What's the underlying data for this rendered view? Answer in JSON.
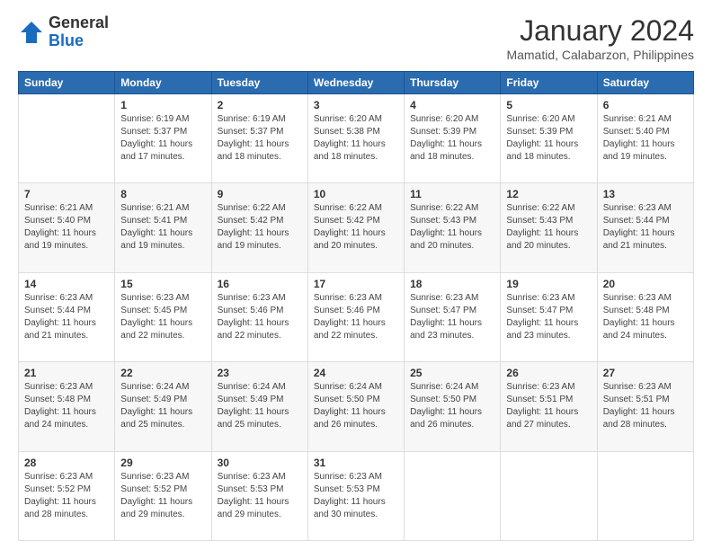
{
  "header": {
    "logo_line1": "General",
    "logo_line2": "Blue",
    "title": "January 2024",
    "subtitle": "Mamatid, Calabarzon, Philippines"
  },
  "calendar": {
    "days_of_week": [
      "Sunday",
      "Monday",
      "Tuesday",
      "Wednesday",
      "Thursday",
      "Friday",
      "Saturday"
    ],
    "weeks": [
      [
        {
          "day": "",
          "info": ""
        },
        {
          "day": "1",
          "info": "Sunrise: 6:19 AM\nSunset: 5:37 PM\nDaylight: 11 hours\nand 17 minutes."
        },
        {
          "day": "2",
          "info": "Sunrise: 6:19 AM\nSunset: 5:37 PM\nDaylight: 11 hours\nand 18 minutes."
        },
        {
          "day": "3",
          "info": "Sunrise: 6:20 AM\nSunset: 5:38 PM\nDaylight: 11 hours\nand 18 minutes."
        },
        {
          "day": "4",
          "info": "Sunrise: 6:20 AM\nSunset: 5:39 PM\nDaylight: 11 hours\nand 18 minutes."
        },
        {
          "day": "5",
          "info": "Sunrise: 6:20 AM\nSunset: 5:39 PM\nDaylight: 11 hours\nand 18 minutes."
        },
        {
          "day": "6",
          "info": "Sunrise: 6:21 AM\nSunset: 5:40 PM\nDaylight: 11 hours\nand 19 minutes."
        }
      ],
      [
        {
          "day": "7",
          "info": "Sunrise: 6:21 AM\nSunset: 5:40 PM\nDaylight: 11 hours\nand 19 minutes."
        },
        {
          "day": "8",
          "info": "Sunrise: 6:21 AM\nSunset: 5:41 PM\nDaylight: 11 hours\nand 19 minutes."
        },
        {
          "day": "9",
          "info": "Sunrise: 6:22 AM\nSunset: 5:42 PM\nDaylight: 11 hours\nand 19 minutes."
        },
        {
          "day": "10",
          "info": "Sunrise: 6:22 AM\nSunset: 5:42 PM\nDaylight: 11 hours\nand 20 minutes."
        },
        {
          "day": "11",
          "info": "Sunrise: 6:22 AM\nSunset: 5:43 PM\nDaylight: 11 hours\nand 20 minutes."
        },
        {
          "day": "12",
          "info": "Sunrise: 6:22 AM\nSunset: 5:43 PM\nDaylight: 11 hours\nand 20 minutes."
        },
        {
          "day": "13",
          "info": "Sunrise: 6:23 AM\nSunset: 5:44 PM\nDaylight: 11 hours\nand 21 minutes."
        }
      ],
      [
        {
          "day": "14",
          "info": "Sunrise: 6:23 AM\nSunset: 5:44 PM\nDaylight: 11 hours\nand 21 minutes."
        },
        {
          "day": "15",
          "info": "Sunrise: 6:23 AM\nSunset: 5:45 PM\nDaylight: 11 hours\nand 22 minutes."
        },
        {
          "day": "16",
          "info": "Sunrise: 6:23 AM\nSunset: 5:46 PM\nDaylight: 11 hours\nand 22 minutes."
        },
        {
          "day": "17",
          "info": "Sunrise: 6:23 AM\nSunset: 5:46 PM\nDaylight: 11 hours\nand 22 minutes."
        },
        {
          "day": "18",
          "info": "Sunrise: 6:23 AM\nSunset: 5:47 PM\nDaylight: 11 hours\nand 23 minutes."
        },
        {
          "day": "19",
          "info": "Sunrise: 6:23 AM\nSunset: 5:47 PM\nDaylight: 11 hours\nand 23 minutes."
        },
        {
          "day": "20",
          "info": "Sunrise: 6:23 AM\nSunset: 5:48 PM\nDaylight: 11 hours\nand 24 minutes."
        }
      ],
      [
        {
          "day": "21",
          "info": "Sunrise: 6:23 AM\nSunset: 5:48 PM\nDaylight: 11 hours\nand 24 minutes."
        },
        {
          "day": "22",
          "info": "Sunrise: 6:24 AM\nSunset: 5:49 PM\nDaylight: 11 hours\nand 25 minutes."
        },
        {
          "day": "23",
          "info": "Sunrise: 6:24 AM\nSunset: 5:49 PM\nDaylight: 11 hours\nand 25 minutes."
        },
        {
          "day": "24",
          "info": "Sunrise: 6:24 AM\nSunset: 5:50 PM\nDaylight: 11 hours\nand 26 minutes."
        },
        {
          "day": "25",
          "info": "Sunrise: 6:24 AM\nSunset: 5:50 PM\nDaylight: 11 hours\nand 26 minutes."
        },
        {
          "day": "26",
          "info": "Sunrise: 6:23 AM\nSunset: 5:51 PM\nDaylight: 11 hours\nand 27 minutes."
        },
        {
          "day": "27",
          "info": "Sunrise: 6:23 AM\nSunset: 5:51 PM\nDaylight: 11 hours\nand 28 minutes."
        }
      ],
      [
        {
          "day": "28",
          "info": "Sunrise: 6:23 AM\nSunset: 5:52 PM\nDaylight: 11 hours\nand 28 minutes."
        },
        {
          "day": "29",
          "info": "Sunrise: 6:23 AM\nSunset: 5:52 PM\nDaylight: 11 hours\nand 29 minutes."
        },
        {
          "day": "30",
          "info": "Sunrise: 6:23 AM\nSunset: 5:53 PM\nDaylight: 11 hours\nand 29 minutes."
        },
        {
          "day": "31",
          "info": "Sunrise: 6:23 AM\nSunset: 5:53 PM\nDaylight: 11 hours\nand 30 minutes."
        },
        {
          "day": "",
          "info": ""
        },
        {
          "day": "",
          "info": ""
        },
        {
          "day": "",
          "info": ""
        }
      ]
    ]
  }
}
